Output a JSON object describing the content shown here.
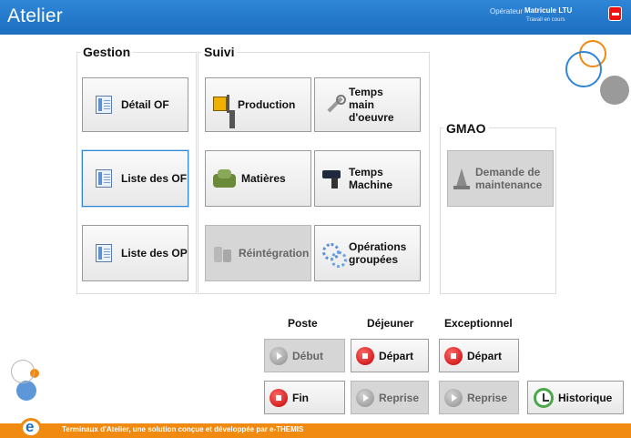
{
  "header": {
    "title": "Atelier",
    "operator_label": "Opérateur",
    "operator_name": "Matricule LTU",
    "operator_status": "Travail en cours",
    "logout_icon": "logout-icon"
  },
  "gestion": {
    "title": "Gestion",
    "buttons": [
      {
        "label": "Détail OF",
        "icon": "document-icon"
      },
      {
        "label": "Liste des OF",
        "icon": "document-list-icon"
      },
      {
        "label": "Liste des OP",
        "icon": "list-icon"
      }
    ]
  },
  "suivi": {
    "title": "Suivi",
    "buttons": [
      {
        "label": "Production",
        "icon": "forklift-icon"
      },
      {
        "label_line1": "Temps",
        "label_line2": "main d'oeuvre",
        "icon": "wrench-icon"
      },
      {
        "label": "Matières",
        "icon": "sacks-icon"
      },
      {
        "label_line1": "Temps",
        "label_line2": "Machine",
        "icon": "drill-icon"
      },
      {
        "label": "Réintégration",
        "icon": "bottles-icon"
      },
      {
        "label_line1": "Opérations",
        "label_line2": "groupées",
        "icon": "gears-icon"
      }
    ]
  },
  "gmao": {
    "title": "GMAO",
    "button": {
      "label_line1": "Demande de",
      "label_line2": "maintenance",
      "icon": "traffic-cone-icon"
    }
  },
  "actions": {
    "poste": {
      "title": "Poste",
      "start": "Début",
      "end": "Fin"
    },
    "dejeuner": {
      "title": "Déjeuner",
      "start": "Départ",
      "end": "Reprise"
    },
    "exceptionnel": {
      "title": "Exceptionnel",
      "start": "Départ",
      "end": "Reprise"
    },
    "historique": "Historique"
  },
  "footer": {
    "text": "Terminaux d'Atelier, une solution conçue et développée par e-THEMIS",
    "logo_letter": "e"
  },
  "colors": {
    "header_blue": "#1c6ec0",
    "footer_orange": "#f08a10",
    "action_red": "#c30000"
  }
}
